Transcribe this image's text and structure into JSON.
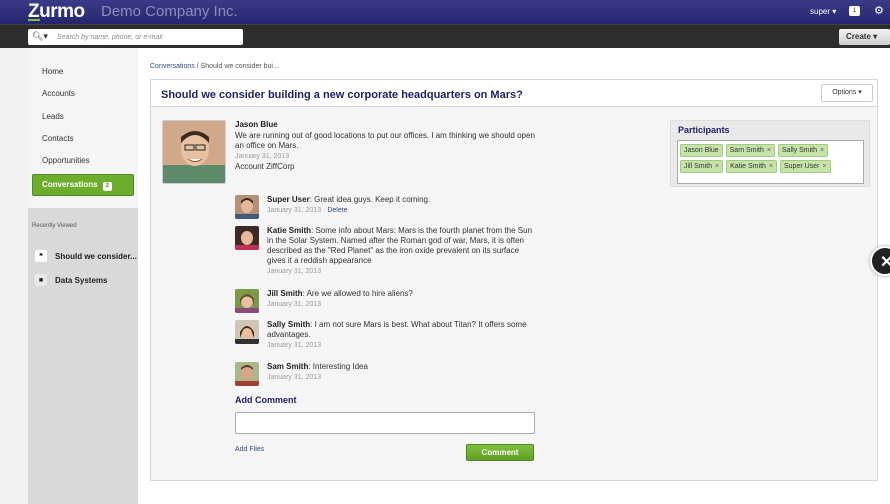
{
  "header": {
    "logo": "Zurmo",
    "company": "Demo Company Inc.",
    "user": "super",
    "notifications": "1",
    "create_label": "Create"
  },
  "search": {
    "placeholder": "Search by name, phone, or e-mail"
  },
  "sidebar": {
    "items": [
      {
        "label": "Home"
      },
      {
        "label": "Accounts"
      },
      {
        "label": "Leads"
      },
      {
        "label": "Contacts"
      },
      {
        "label": "Opportunities"
      },
      {
        "label": "Conversations",
        "badge": "2"
      }
    ],
    "recent_title": "Recently Viewed",
    "recent": [
      {
        "label": "Should we consider...",
        "icon": "conversation-icon"
      },
      {
        "label": "Data Systems",
        "icon": "folder-icon"
      }
    ]
  },
  "breadcrumb": {
    "link": "Conversations",
    "current": " / Should we consider bui..."
  },
  "conversation": {
    "title": "Should we consider building a new corporate headquarters on Mars?",
    "options_label": "Options ▾",
    "author": "Jason Blue",
    "text": "We are running out of good locations to put our offices. I am thinking we should open an office on Mars.",
    "date": "January 31, 2013",
    "account": "Account ZiffCorp"
  },
  "participants": {
    "title": "Participants",
    "list": [
      "Jason Blue",
      "Sam Smith",
      "Sally Smith",
      "Jill Smith",
      "Katie Smith",
      "Super User"
    ]
  },
  "comments": [
    {
      "name": "Super User",
      "text": "Great idea guys. Keep it coming.",
      "date": "January 31, 2013",
      "action": "Delete"
    },
    {
      "name": "Katie Smith",
      "text": "Some info about Mars: Mars is the fourth planet from the Sun in the Solar System. Named after the Roman god of war, Mars, it is often described as the \"Red Planet\" as the iron oxide prevalent on its surface gives it a reddish appearance",
      "date": "January 31, 2013"
    },
    {
      "name": "Jill Smith",
      "text": "Are we allowed to hire aliens?",
      "date": "January 31, 2013"
    },
    {
      "name": "Sally Smith",
      "text": "I am not sure Mars is best. What about Titan? It offers some advantages.",
      "date": "January 31, 2013"
    },
    {
      "name": "Sam Smith",
      "text": "Interesting Idea",
      "date": "January 31, 2013"
    }
  ],
  "add_comment": {
    "title": "Add Comment",
    "add_files": "Add Files",
    "button": "Comment"
  },
  "colors": {
    "brand": "#2b2b78",
    "accent": "#6cae2b",
    "link": "#2e4d7e"
  }
}
